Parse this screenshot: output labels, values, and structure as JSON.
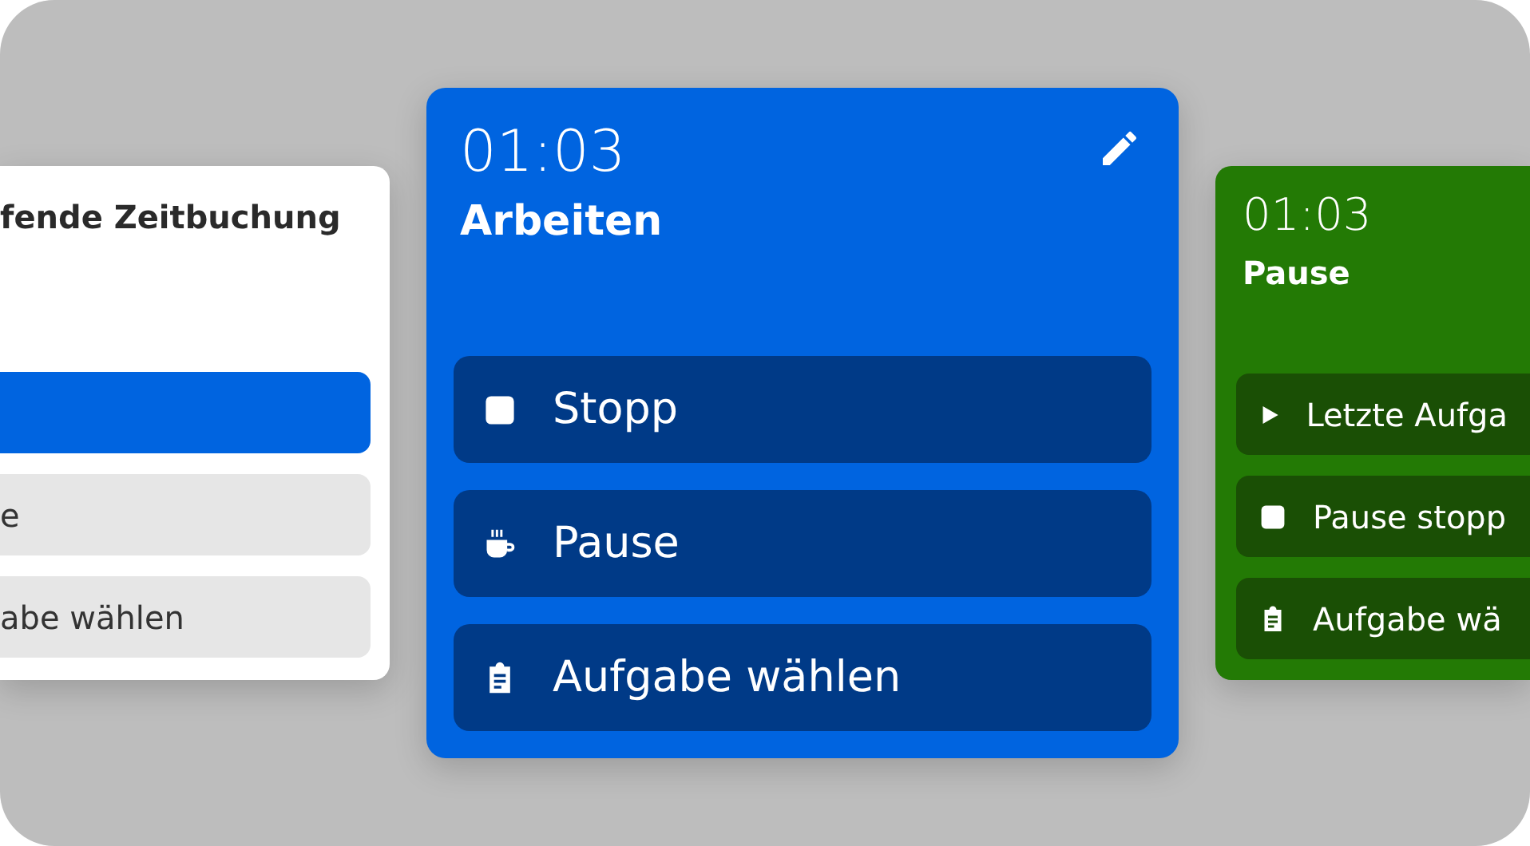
{
  "cards": [
    {
      "kind": "light",
      "title": "fende Zeitbuchung",
      "editable": false,
      "buttons": [
        {
          "kind": "primary"
        },
        {
          "kind": "plain",
          "label": "e"
        },
        {
          "kind": "plain",
          "label": "abe wählen"
        }
      ]
    },
    {
      "kind": "blue",
      "time": "01:03",
      "title": "Arbeiten",
      "editable": true,
      "buttons": [
        {
          "kind": "stop",
          "label": "Stopp"
        },
        {
          "kind": "pause",
          "label": "Pause"
        },
        {
          "kind": "choose-task",
          "label": "Aufgabe wählen"
        }
      ]
    },
    {
      "kind": "green",
      "time": "01:03",
      "title": "Pause",
      "editable": false,
      "buttons": [
        {
          "kind": "resume",
          "label": "Letzte Aufga"
        },
        {
          "kind": "stop",
          "label": "Pause stopp"
        },
        {
          "kind": "choose-task",
          "label": "Aufgabe wä"
        }
      ]
    }
  ]
}
